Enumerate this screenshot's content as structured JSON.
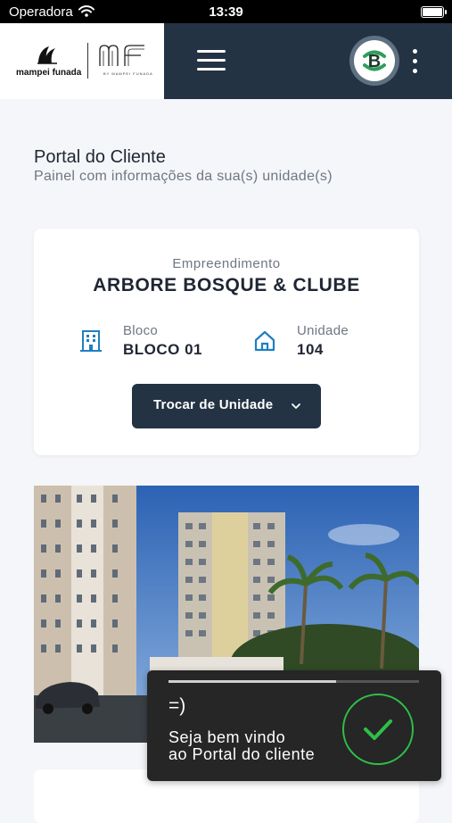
{
  "status_bar": {
    "carrier": "Operadora",
    "time": "13:39"
  },
  "header": {
    "brand": "mampei funada",
    "brand_mark": "MF",
    "brand_mark_sub": "BY MAMPEI FUNADA",
    "avatar_letter": "B",
    "accent_color": "#243344",
    "avatar_color": "#2e9f5a"
  },
  "page": {
    "title": "Portal do Cliente",
    "subtitle": "Painel com informações da sua(s) unidade(s)"
  },
  "unit_card": {
    "development_label": "Empreendimento",
    "development_name": "ARBORE BOSQUE & CLUBE",
    "block_label": "Bloco",
    "block_value": "BLOCO 01",
    "unit_label": "Unidade",
    "unit_value": "104",
    "switch_button": "Trocar de Unidade",
    "icon_color": "#1f7fc1"
  },
  "toast": {
    "emoticon": "=)",
    "message_line1": "Seja bem vindo",
    "message_line2": "ao Portal do cliente",
    "progress": 0.67,
    "success_color": "#2fbf48"
  }
}
